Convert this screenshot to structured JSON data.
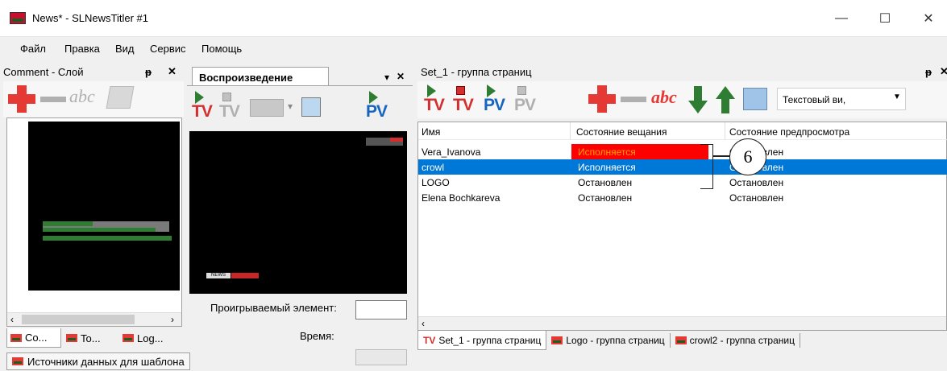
{
  "window": {
    "title": "News* - SLNewsTitler #1",
    "minimize": "—",
    "maximize": "☐",
    "close": "✕"
  },
  "menu": [
    "Файл",
    "Правка",
    "Вид",
    "Сервис",
    "Помощь"
  ],
  "left_panel": {
    "title": "Comment - Слой",
    "pin": "ᵽ",
    "close": "✕",
    "abc": "abc",
    "layer_label": "Comment",
    "tabs": [
      "Co...",
      "To...",
      "Log..."
    ]
  },
  "middle_panel": {
    "tab": "Воспроизведение",
    "dropdown": "▾",
    "close": "✕",
    "tv": "TV",
    "pv": "PV",
    "preview_logo": "NEWS",
    "played_label": "Проигрываемый элемент:",
    "time_label": "Время:"
  },
  "right_panel": {
    "title": "Set_1 - группа страниц",
    "pin": "ᵽ",
    "close": "✕",
    "abc": "abc",
    "view_select": "Текстовый ви,",
    "columns": [
      "Имя",
      "Состояние вещания",
      "Состояние предпросмотра"
    ],
    "rows": [
      {
        "name": "Vera_Ivanova",
        "broadcast": "Исполняется",
        "preview": "Остановлен",
        "state": "error"
      },
      {
        "name": "crowl",
        "broadcast": "Исполняется",
        "preview": "Остановлен",
        "state": "selected"
      },
      {
        "name": "LOGO",
        "broadcast": "Остановлен",
        "preview": "Остановлен",
        "state": "normal"
      },
      {
        "name": "Elena Bochkareva",
        "broadcast": "Остановлен",
        "preview": "Остановлен",
        "state": "normal"
      }
    ],
    "callout": "6",
    "tabs": [
      "Set_1 - группа страниц",
      "Logo - группа страниц",
      "crowl2 - группа страниц"
    ],
    "tab_prefix": "TV"
  },
  "status_tab": "Источники данных для шаблона",
  "colors": {
    "accent_blue": "#0078d7",
    "error_red": "#ff0000",
    "green": "#2e7d32",
    "red": "#e53935"
  }
}
